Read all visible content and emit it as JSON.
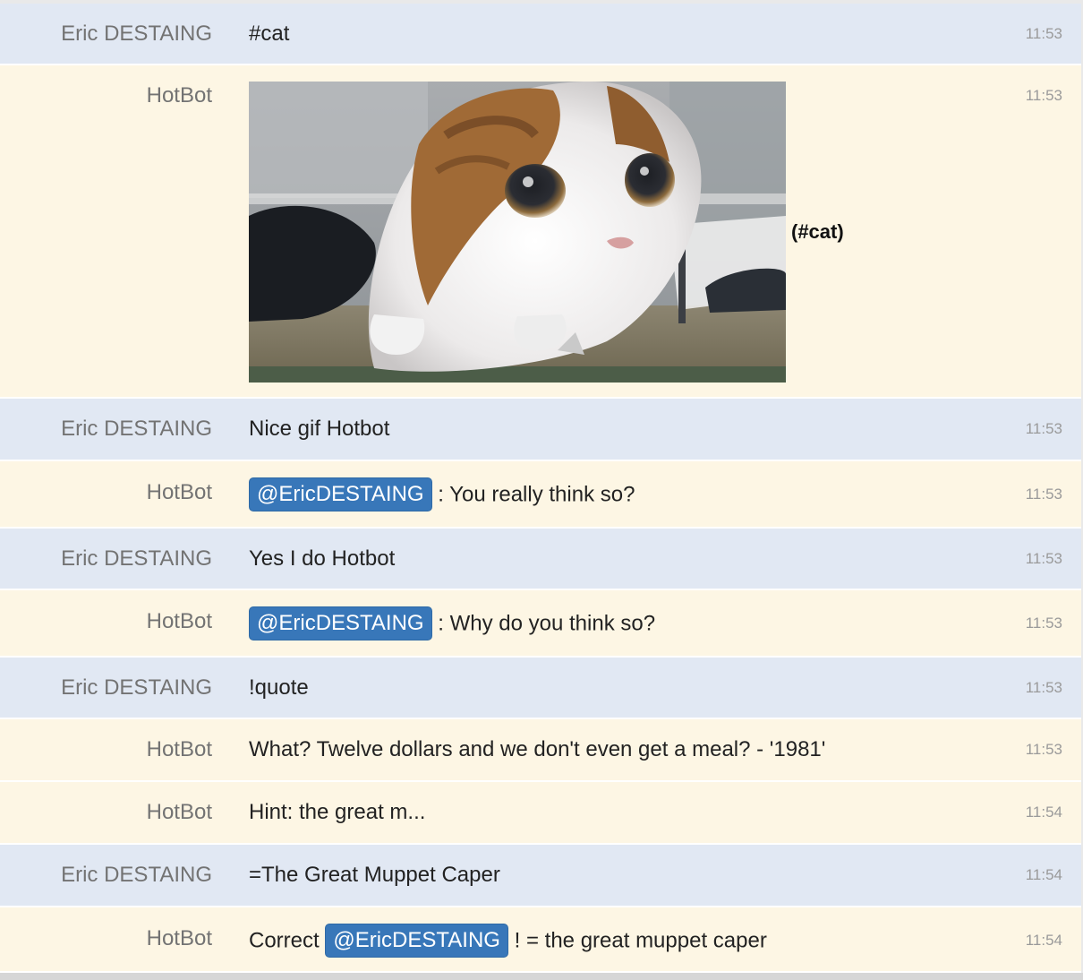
{
  "messages": [
    {
      "author": "Eric DESTAING",
      "text": "#cat",
      "time": "11:53"
    },
    {
      "author": "HotBot",
      "caption": "(#cat)",
      "time": "11:53"
    },
    {
      "author": "Eric DESTAING",
      "text": "Nice gif Hotbot",
      "time": "11:53"
    },
    {
      "author": "HotBot",
      "mention": "@EricDESTAING",
      "after": ": You really think so?",
      "time": "11:53"
    },
    {
      "author": "Eric DESTAING",
      "text": "Yes I do Hotbot",
      "time": "11:53"
    },
    {
      "author": "HotBot",
      "mention": "@EricDESTAING",
      "after": ": Why do you think so?",
      "time": "11:53"
    },
    {
      "author": "Eric DESTAING",
      "text": "!quote",
      "time": "11:53"
    },
    {
      "author": "HotBot",
      "text": "What? Twelve dollars and we don't even get a meal? - '1981'",
      "time": "11:53"
    },
    {
      "author": "HotBot",
      "text": "Hint: the great m...",
      "time": "11:54"
    },
    {
      "author": "Eric DESTAING",
      "text": "=The Great Muppet Caper",
      "time": "11:54"
    },
    {
      "author": "HotBot",
      "before": "Correct",
      "mention": "@EricDESTAING",
      "after": "! = the great muppet caper",
      "time": "11:54"
    }
  ]
}
